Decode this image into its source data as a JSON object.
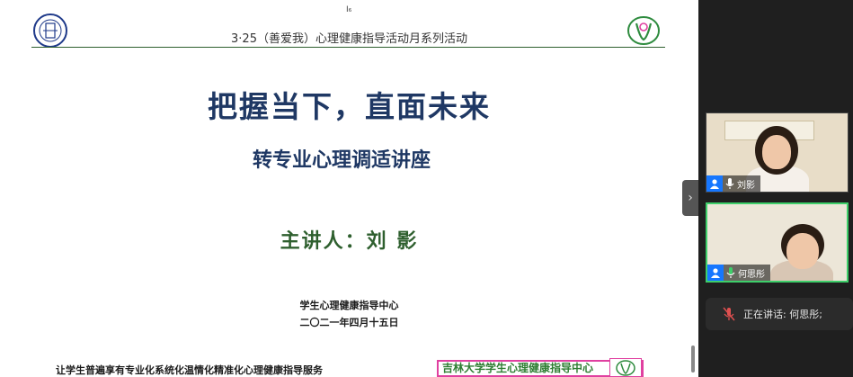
{
  "slide": {
    "header": "3·25（善爱我）心理健康指导活动月系列活动",
    "cursor_marker": "I₆",
    "title": "把握当下，直面未来",
    "subtitle": "转专业心理调适讲座",
    "speaker": "主讲人：刘  影",
    "org": "学生心理健康指导中心",
    "date": "二〇二一年四月十五日",
    "footer_left": "让学生普遍享有专业化系统化温情化精准化心理健康指导服务",
    "footer_right": "吉林大学学生心理健康指导中心",
    "colors": {
      "title": "#1f3864",
      "speaker": "#2e5f2e",
      "footer_right_border": "#e040a0",
      "footer_right_text": "#2e7d32"
    }
  },
  "participants": [
    {
      "name": "刘影",
      "icon": "user-icon",
      "mic": "mic-icon"
    },
    {
      "name": "何思彤",
      "icon": "user-icon",
      "mic": "mic-active-icon",
      "active_speaker": true
    }
  ],
  "speaking_indicator": {
    "text": "正在讲话: 何思彤;",
    "icon": "mic-muted-icon"
  },
  "collapse": {
    "label": "›"
  }
}
